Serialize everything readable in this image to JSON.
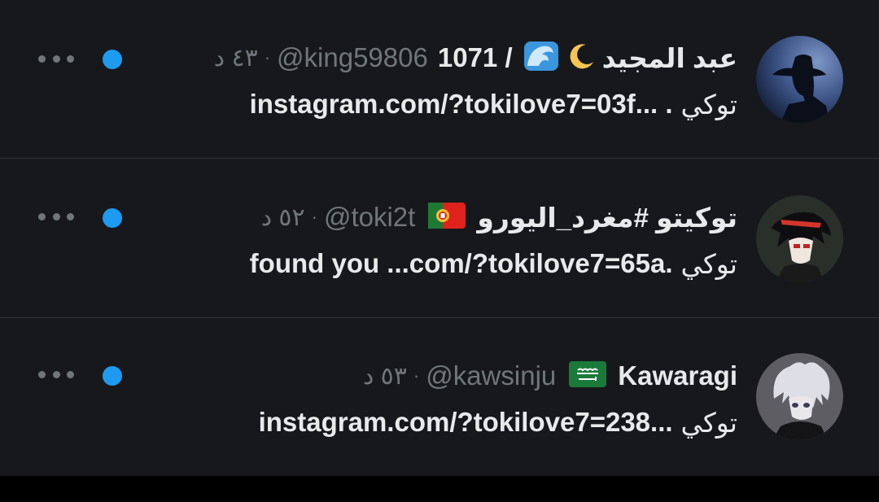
{
  "conversations": [
    {
      "name": "عبد المجيد",
      "name_extra": "1071 /",
      "emojis": [
        "crescent-moon",
        "water-wave"
      ],
      "handle": "@king59806",
      "time": "٤٣ د",
      "preview_ar": "توكي",
      "preview_rest": "instagram.com/?tokilove7=03f... .",
      "unread": true
    },
    {
      "name": "توكيتو #مغرد_اليورو",
      "emojis": [
        "portugal-flag"
      ],
      "handle": "@toki2t",
      "time": "٥٢ د",
      "preview_ar": "توكي",
      "preview_rest": "found you ...com/?tokilove7=65a.",
      "unread": true
    },
    {
      "name": "Kawaragi",
      "emojis": [
        "saudi-flag"
      ],
      "handle": "@kawsinju",
      "time": "٥٣ د",
      "preview_ar": "توكي",
      "preview_rest": "instagram.com/?tokilove7=238...",
      "unread": true
    }
  ],
  "colors": {
    "background": "#17181c",
    "text_primary": "#e7e9ea",
    "text_secondary": "#71767b",
    "accent": "#1d9bf0",
    "divider": "#2f3336"
  }
}
